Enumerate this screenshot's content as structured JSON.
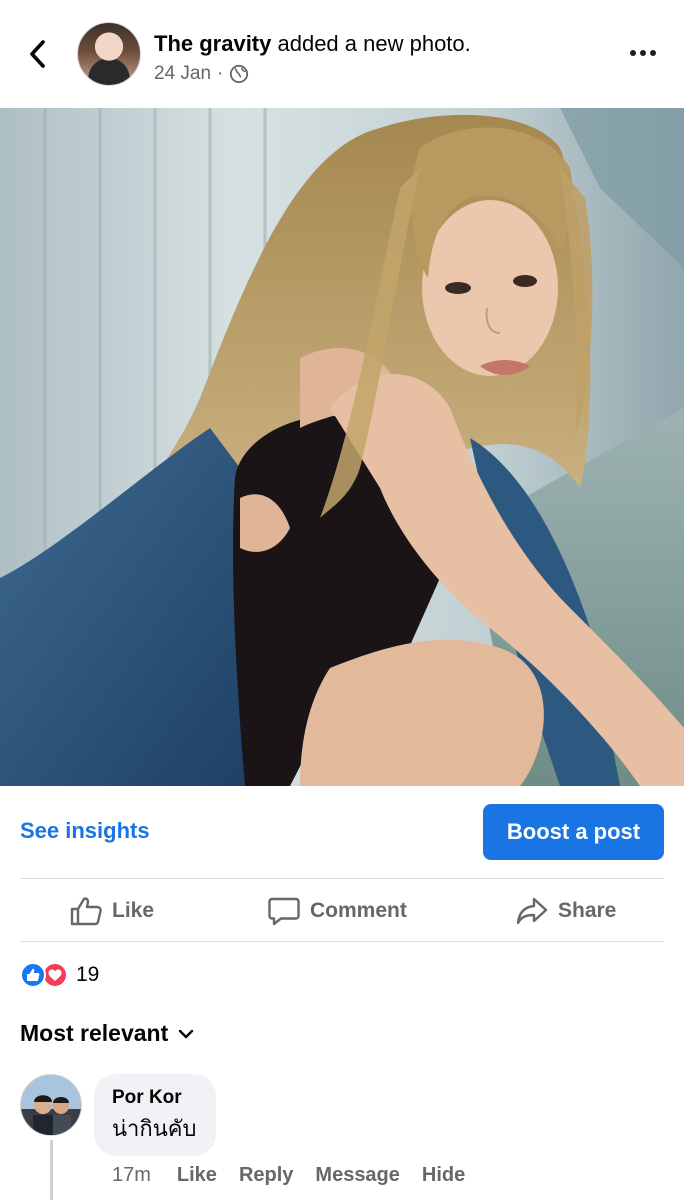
{
  "header": {
    "author_name": "The gravity",
    "action_text": " added a new photo.",
    "date": "24 Jan",
    "separator": "·"
  },
  "icons": {
    "back": "chevron-left-icon",
    "more": "more-horizontal-icon",
    "audience": "globe-icon",
    "like": "thumbs-up-icon",
    "comment": "speech-bubble-icon",
    "share": "share-arrow-icon"
  },
  "post_actions": {
    "insights_label": "See insights",
    "boost_label": "Boost a post"
  },
  "reaction_bar": {
    "like_label": "Like",
    "comment_label": "Comment",
    "share_label": "Share"
  },
  "reactions": {
    "count": "19",
    "types": [
      "like",
      "love"
    ]
  },
  "comments_sort": {
    "label": "Most relevant"
  },
  "comments": [
    {
      "author": "Por Kor",
      "text": "น่ากินคับ",
      "time": "17m",
      "actions": [
        "Like",
        "Reply",
        "Message",
        "Hide"
      ]
    }
  ],
  "colors": {
    "accent": "#1b74e4",
    "like_reaction": "#1877f2",
    "love_reaction": "#f33e58",
    "secondary_text": "#65676b",
    "bubble_bg": "#f0f2f5"
  }
}
